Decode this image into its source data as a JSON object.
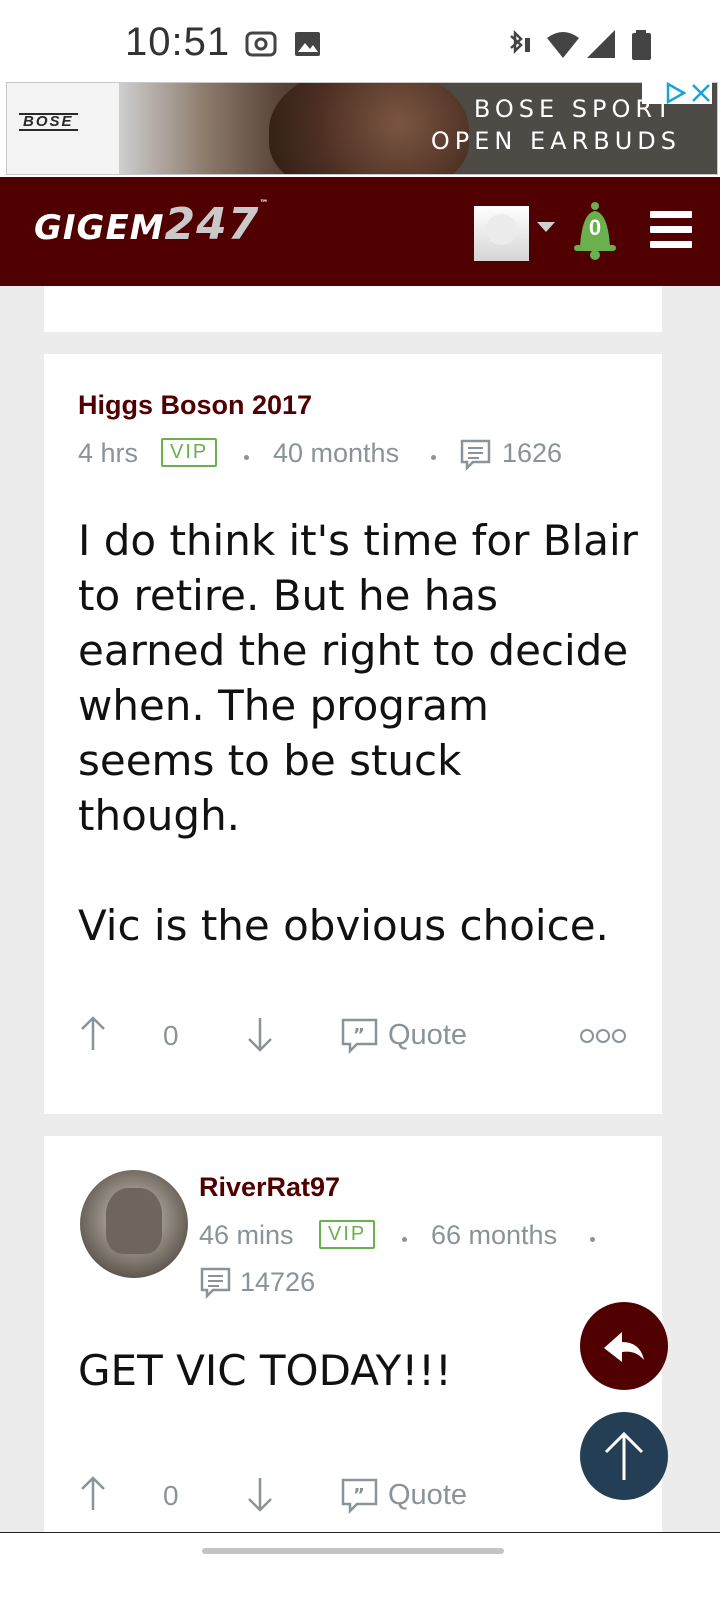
{
  "status_bar": {
    "time": "10:51"
  },
  "ad": {
    "brand": "BOSE",
    "line1": "BOSE SPORT",
    "line2": "OPEN EARBUDS"
  },
  "header": {
    "logo_text": "GIGEM",
    "logo_num": "247",
    "logo_tm": "™",
    "notifications": "0"
  },
  "posts": [
    {
      "author": "Higgs Boson 2017",
      "time": "4 hrs",
      "badge": "VIP",
      "tenure": "40 months",
      "post_count": "1626",
      "body": "I do think it's time for Blair\nto retire. But he has\nearned the right to decide\nwhen. The program\nseems to be stuck\nthough.\n\nVic is the obvious choice.",
      "votes": "0",
      "quote_label": "Quote"
    },
    {
      "author": "RiverRat97",
      "time": "46 mins",
      "badge": "VIP",
      "tenure": "66 months",
      "post_count": "14726",
      "body": "GET VIC TODAY!!!",
      "votes": "0",
      "quote_label": "Quote"
    }
  ],
  "colors": {
    "maroon": "#500000",
    "vip_green": "#6ab04c",
    "fab_blue": "#233e55"
  }
}
